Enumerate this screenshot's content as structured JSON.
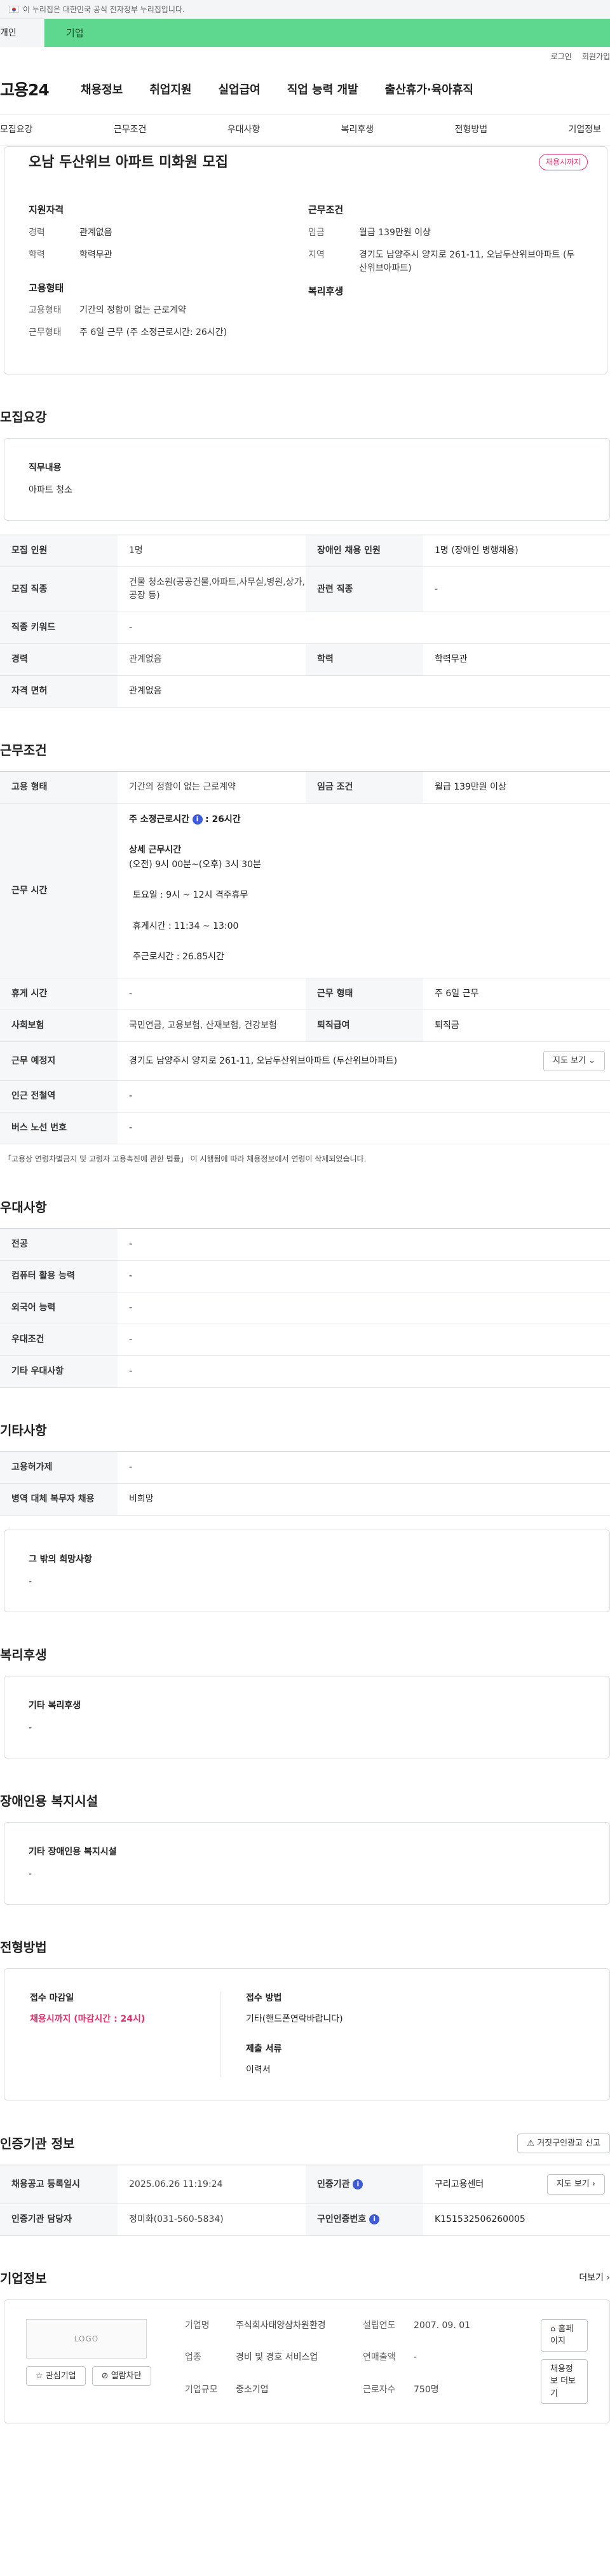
{
  "gov_banner": "이 누리집은 대한민국 공식 전자정부 누리집입니다.",
  "tabs": [
    "개인",
    "기업"
  ],
  "util": [
    "로그인",
    "회원가입"
  ],
  "logo": "고용24",
  "gnb": [
    "채용정보",
    "취업지원",
    "실업급여",
    "직업 능력 개발",
    "출산휴가·육아휴직"
  ],
  "anchors": [
    "모집요강",
    "근무조건",
    "우대사항",
    "복리후생",
    "전형방법",
    "기업정보"
  ],
  "summary": {
    "title": "오남 두산위브 아파트 미화원 모집",
    "badge": "채용시까지",
    "qual_h": "지원자격",
    "qual": [
      {
        "k": "경력",
        "v": "관계없음"
      },
      {
        "k": "학력",
        "v": "학력무관"
      }
    ],
    "emp_h": "고용형태",
    "emp": [
      {
        "k": "고용형태",
        "v": "기간의 정함이 없는 근로계약"
      },
      {
        "k": "근무형태",
        "v": "주 6일 근무 (주 소정근로시간: 26시간)"
      }
    ],
    "cond_h": "근무조건",
    "cond": [
      {
        "k": "임금",
        "v": "월급 139만원 이상"
      },
      {
        "k": "지역",
        "v": "경기도 남양주시 양지로 261-11, 오남두산위브아파트 (두산위브아파트)"
      }
    ],
    "wel_h": "복리후생"
  },
  "recruit": {
    "title": "모집요강",
    "duty_h": "직무내용",
    "duty": "아파트 청소",
    "rows": [
      [
        "모집 인원",
        "1명",
        "장애인 채용 인원",
        "1명 (장애인 병행채용)"
      ],
      [
        "모집 직종",
        "건물 청소원(공공건물,아파트,사무실,병원,상가,공장 등)",
        "관련 직종",
        "-"
      ],
      [
        "직종 키워드",
        "-",
        "",
        ""
      ],
      [
        "경력",
        "관계없음",
        "학력",
        "학력무관"
      ],
      [
        "자격 면허",
        "관계없음",
        "",
        ""
      ]
    ]
  },
  "work": {
    "title": "근무조건",
    "r1": [
      "고용 형태",
      "기간의 정함이 없는 근로계약",
      "임금 조건",
      "월급 139만원 이상"
    ],
    "time_label": "근무 시간",
    "time_week": "주 소정근로시간",
    "time_week_val": "26시간",
    "time_detail_h": "상세 근무시간",
    "time_lines": [
      "(오전) 9시 00분~(오후) 3시 30분",
      "토요일 :  9시 ~ 12시 격주휴무",
      "휴게시간 : 11:34 ~ 13:00",
      "주근로시간 : 26.85시간"
    ],
    "r2": [
      "휴게 시간",
      "-",
      "근무 형태",
      "주 6일 근무"
    ],
    "r3": [
      "사회보험",
      "국민연금, 고용보험, 산재보험, 건강보험",
      "퇴직급여",
      "퇴직금"
    ],
    "r4": [
      "근무 예정지",
      "경기도 남양주시 양지로 261-11, 오남두산위브아파트 (두산위브아파트)"
    ],
    "map_btn": "지도 보기",
    "r5": [
      "인근 전철역",
      "-"
    ],
    "r6": [
      "버스 노선 번호",
      "-"
    ],
    "note": "「고용상 연령차별금지 및 고령자 고용촉진에 관한 법률」 이 시행됨에 따라 채용정보에서 연령이 삭제되었습니다."
  },
  "pref": {
    "title": "우대사항",
    "rows": [
      [
        "전공",
        "-"
      ],
      [
        "컴퓨터 활용 능력",
        "-"
      ],
      [
        "외국어 능력",
        "-"
      ],
      [
        "우대조건",
        "-"
      ],
      [
        "기타 우대사항",
        "-"
      ]
    ]
  },
  "etc": {
    "title": "기타사항",
    "rows": [
      [
        "고용허가제",
        "-"
      ],
      [
        "병역 대체 복무자 채용",
        "비희망"
      ]
    ],
    "hope_h": "그 밖의 희망사항",
    "hope": "-"
  },
  "welfare": {
    "title": "복리후생",
    "h": "기타 복리후생",
    "v": "-"
  },
  "disab": {
    "title": "장애인용 복지시설",
    "h": "기타 장애인용 복지시설",
    "v": "-"
  },
  "process": {
    "title": "전형방법",
    "deadline_h": "접수 마감일",
    "deadline": "채용시까지 (마감시간 : 24시)",
    "method_h": "접수 방법",
    "method": "기타(핸드폰연락바랍니다)",
    "docs_h": "제출 서류",
    "docs": "이력서"
  },
  "agency": {
    "title": "인증기관 정보",
    "report_btn": "거짓구인광고 신고",
    "rows": [
      [
        "채용공고 등록일시",
        "2025.06.26 11:19:24",
        "인증기관",
        "구리고용센터"
      ],
      [
        "인증기관 담당자",
        "정미화(031-560-5834)",
        "구인인증번호",
        "K151532506260005"
      ]
    ],
    "map_btn": "지도 보기"
  },
  "company": {
    "title": "기업정보",
    "more": "더보기",
    "logo": "LOGO",
    "fav": "관심기업",
    "block": "열람차단",
    "info": [
      [
        "기업명",
        "주식회사태양삼차원환경",
        "설립연도",
        "2007. 09. 01"
      ],
      [
        "업종",
        "경비 및 경호 서비스업",
        "연매출액",
        "-"
      ],
      [
        "기업규모",
        "중소기업",
        "근로자수",
        "750명"
      ]
    ],
    "home": "홈페이지",
    "jobs": "채용정보 더보기"
  }
}
